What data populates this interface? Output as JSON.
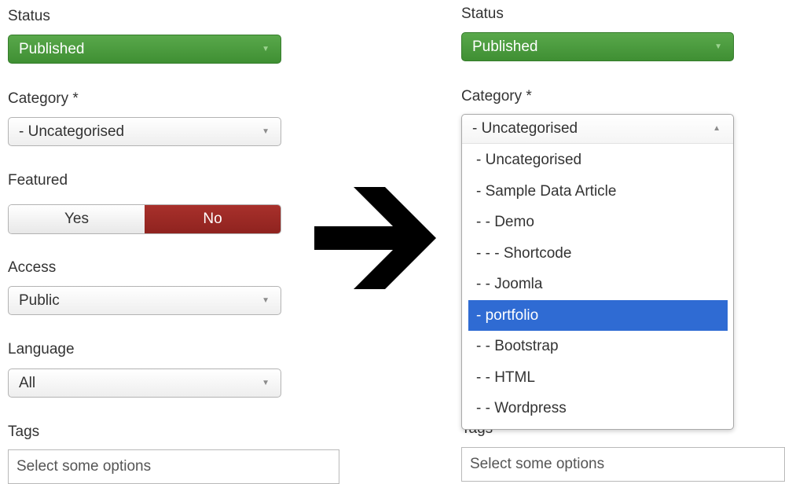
{
  "left": {
    "status_label": "Status",
    "status_value": "Published",
    "category_label": "Category *",
    "category_value": "- Uncategorised",
    "featured_label": "Featured",
    "featured_yes": "Yes",
    "featured_no": "No",
    "access_label": "Access",
    "access_value": "Public",
    "language_label": "Language",
    "language_value": "All",
    "tags_label": "Tags",
    "tags_placeholder": "Select some options"
  },
  "right": {
    "status_label": "Status",
    "status_value": "Published",
    "category_label": "Category *",
    "category_value": "- Uncategorised",
    "category_options": [
      "- Uncategorised",
      "- Sample Data Article",
      "- - Demo",
      "- - - Shortcode",
      "- - Joomla",
      "- portfolio",
      "- - Bootstrap",
      "- - HTML",
      "- - Wordpress"
    ],
    "highlighted_option": "- portfolio",
    "tags_label": "Tags",
    "tags_placeholder": "Select some options"
  },
  "icons": {
    "dropdown_caret": "caret-down-icon",
    "dropdown_caret_open": "caret-up-icon",
    "arrow": "right-arrow-icon"
  },
  "colors": {
    "published_green": "#4a9b3e",
    "featured_no_red": "#9b2a25",
    "highlight_blue": "#2f6bd3"
  }
}
